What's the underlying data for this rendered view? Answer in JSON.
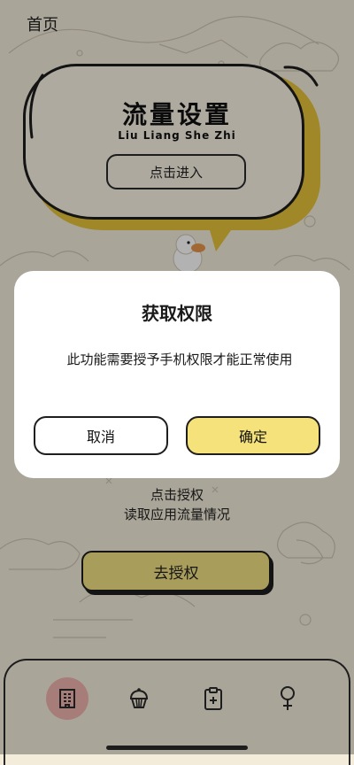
{
  "header": {
    "title": "首页"
  },
  "banner": {
    "title": "流量设置",
    "subtitle": "Liu Liang She Zhi",
    "enter_label": "点击进入"
  },
  "permission_section": {
    "hint_line1": "点击授权",
    "hint_line2": "读取应用流量情况",
    "auth_label": "去授权"
  },
  "tabbar": {
    "items": [
      {
        "icon": "building-icon",
        "active": true
      },
      {
        "icon": "cupcake-icon",
        "active": false
      },
      {
        "icon": "clipboard-plus-icon",
        "active": false
      },
      {
        "icon": "female-icon",
        "active": false
      }
    ]
  },
  "dialog": {
    "title": "获取权限",
    "message": "此功能需要授予手机权限才能正常使用",
    "cancel_label": "取消",
    "confirm_label": "确定"
  },
  "colors": {
    "accent_yellow": "#f6e27a",
    "cloud_shadow": "#e5c23a",
    "active_tab": "#f0b4ae",
    "background": "#f4ecdb"
  }
}
